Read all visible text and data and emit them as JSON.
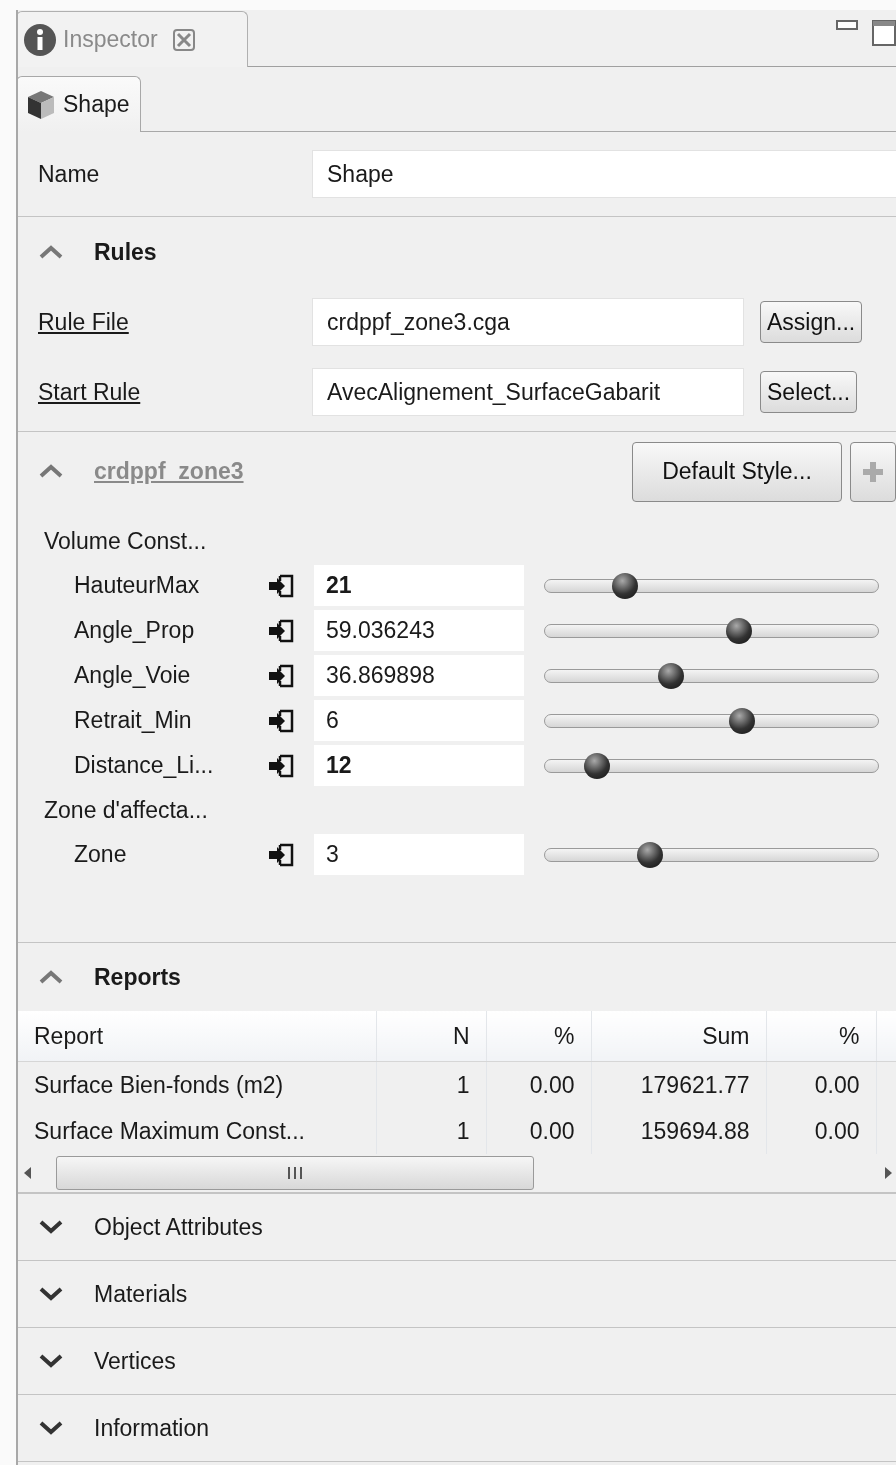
{
  "view_tab": {
    "title": "Inspector",
    "selected": true
  },
  "object_tab": {
    "label": "Shape",
    "selected": true
  },
  "name_row": {
    "label": "Name",
    "value": "Shape"
  },
  "rules": {
    "title": "Rules",
    "expanded": true,
    "rows": [
      {
        "label": "Rule File",
        "value": "crdppf_zone3.cga",
        "button": "Assign..."
      },
      {
        "label": "Start Rule",
        "value": "AvecAlignement_SurfaceGabarit",
        "button": "Select..."
      }
    ]
  },
  "attributes": {
    "title": "crdppf_zone3",
    "expanded": true,
    "disabled": true,
    "style_button": "Default Style...",
    "add_button": {
      "disabled": true
    },
    "groups": [
      {
        "title": "Volume Const...",
        "params": [
          {
            "name": "HauteurMax",
            "value": "21",
            "bold": true,
            "level": 0.22
          },
          {
            "name": "Angle_Prop",
            "value": "59.036243",
            "bold": false,
            "level": 0.59
          },
          {
            "name": "Angle_Voie",
            "value": "36.869898",
            "bold": false,
            "level": 0.37
          },
          {
            "name": "Retrait_Min",
            "value": "6",
            "bold": false,
            "level": 0.6
          },
          {
            "name": "Distance_Li...",
            "value": "12",
            "bold": true,
            "level": 0.13
          }
        ]
      },
      {
        "title": "Zone d'affecta...",
        "params": [
          {
            "name": "Zone",
            "value": "3",
            "bold": false,
            "level": 0.3
          }
        ]
      }
    ]
  },
  "reports": {
    "title": "Reports",
    "expanded": true,
    "columns": [
      "Report",
      "N",
      "%",
      "Sum",
      "%"
    ],
    "rows": [
      [
        "Surface Bien-fonds (m2)",
        "1",
        "0.00",
        "179621.77",
        "0.00"
      ],
      [
        "Surface Maximum Const...",
        "1",
        "0.00",
        "159694.88",
        "0.00"
      ]
    ]
  },
  "collapsed_sections": [
    {
      "title": "Object Attributes",
      "expanded": false
    },
    {
      "title": "Materials",
      "expanded": false
    },
    {
      "title": "Vertices",
      "expanded": false
    },
    {
      "title": "Information",
      "expanded": false
    }
  ]
}
